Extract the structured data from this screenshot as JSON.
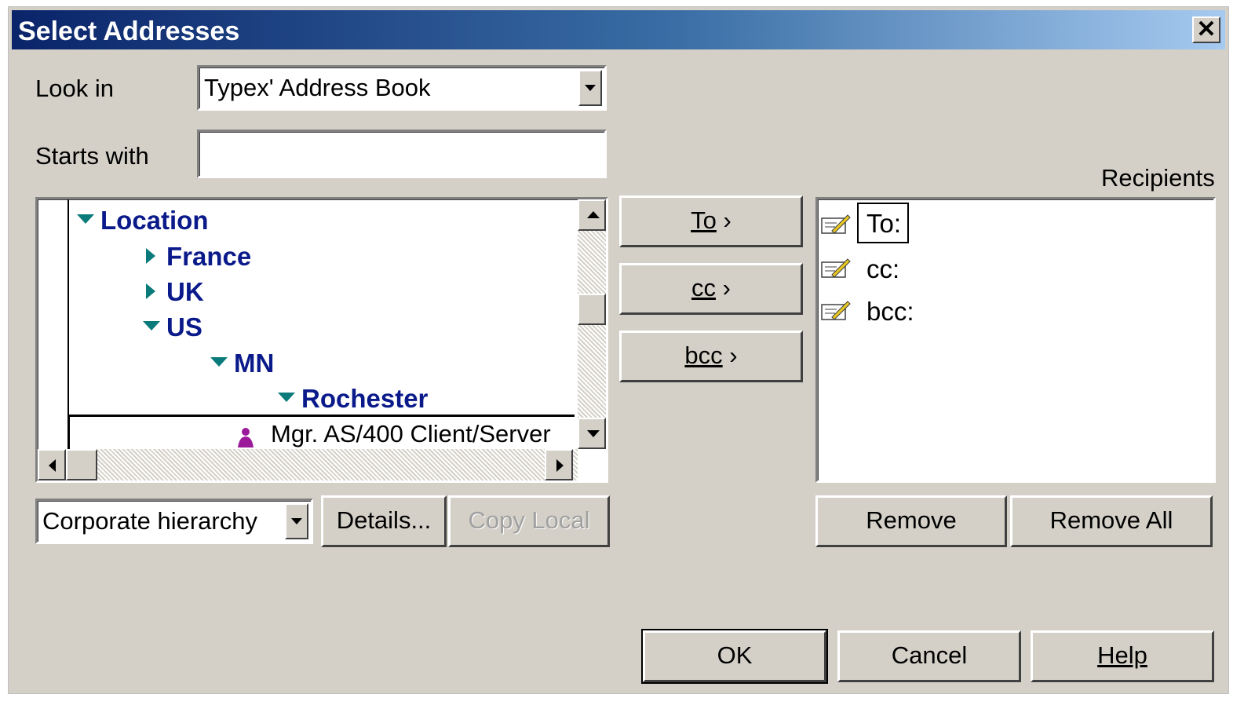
{
  "window": {
    "title": "Select Addresses"
  },
  "look_in": {
    "label": "Look in",
    "value": "Typex' Address Book"
  },
  "starts_with": {
    "label": "Starts with",
    "value": ""
  },
  "tree": {
    "items": [
      {
        "label": "Location",
        "state": "expanded"
      },
      {
        "label": "France",
        "state": "collapsed"
      },
      {
        "label": "UK",
        "state": "collapsed"
      },
      {
        "label": "US",
        "state": "expanded"
      },
      {
        "label": "MN",
        "state": "expanded"
      },
      {
        "label": "Rochester",
        "state": "expanded"
      }
    ],
    "selected_entry": "Mgr. AS/400 Client/Server"
  },
  "view_select": {
    "value": "Corporate hierarchy"
  },
  "buttons": {
    "details": "Details...",
    "copy_local": "Copy Local",
    "to": "To",
    "cc": "cc",
    "bcc": "bcc",
    "remove": "Remove",
    "remove_all": "Remove All",
    "ok": "OK",
    "cancel": "Cancel",
    "help": "Help"
  },
  "recipients": {
    "label": "Recipients",
    "fields": [
      "To:",
      "cc:",
      "bcc:"
    ]
  },
  "colors": {
    "title_start": "#0a246a",
    "title_end": "#a6caf0",
    "tree_text": "#0a1a8a",
    "tree_arrow": "#0a7a7a"
  }
}
